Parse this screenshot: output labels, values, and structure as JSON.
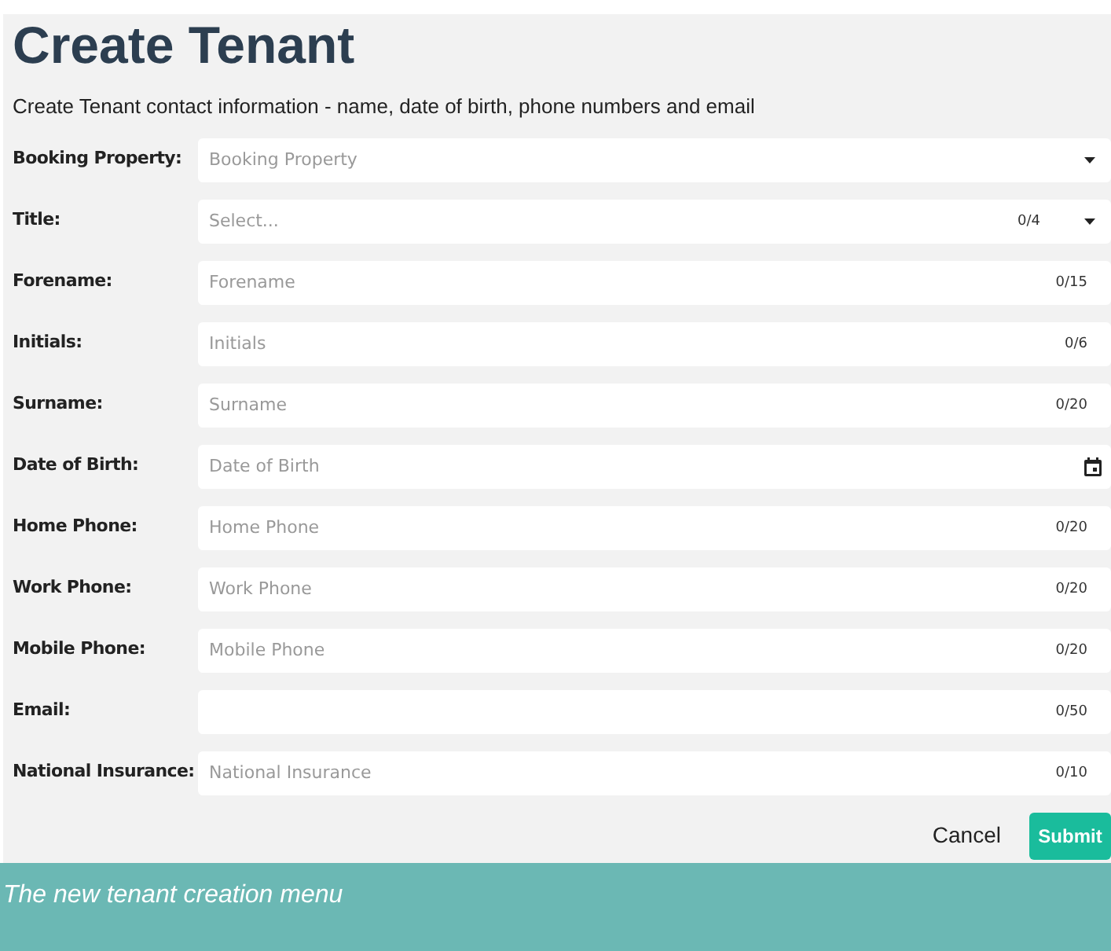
{
  "title": "Create Tenant",
  "subtitle": "Create Tenant contact information - name, date of birth, phone numbers and email",
  "fields": [
    {
      "label": "Booking Property:",
      "kind": "select",
      "placeholder": "Booking Property"
    },
    {
      "label": "Title:",
      "kind": "select",
      "placeholder": "Select...",
      "counter": "0/4"
    },
    {
      "label": "Forename:",
      "kind": "text",
      "placeholder": "Forename",
      "counter": "0/15"
    },
    {
      "label": "Initials:",
      "kind": "text",
      "placeholder": "Initials",
      "counter": "0/6"
    },
    {
      "label": "Surname:",
      "kind": "text",
      "placeholder": "Surname",
      "counter": "0/20"
    },
    {
      "label": "Date of Birth:",
      "kind": "date",
      "placeholder": "Date of Birth"
    },
    {
      "label": "Home Phone:",
      "kind": "text",
      "placeholder": "Home Phone",
      "counter": "0/20"
    },
    {
      "label": "Work Phone:",
      "kind": "text",
      "placeholder": "Work Phone",
      "counter": "0/20"
    },
    {
      "label": "Mobile Phone:",
      "kind": "text",
      "placeholder": "Mobile Phone",
      "counter": "0/20"
    },
    {
      "label": "Email:",
      "kind": "text",
      "counter": "0/50"
    },
    {
      "label": "National Insurance:",
      "kind": "text",
      "placeholder": "National Insurance",
      "counter": "0/10"
    }
  ],
  "buttons": {
    "cancel": "Cancel",
    "submit": "Submit"
  },
  "caption": "The new tenant creation menu"
}
